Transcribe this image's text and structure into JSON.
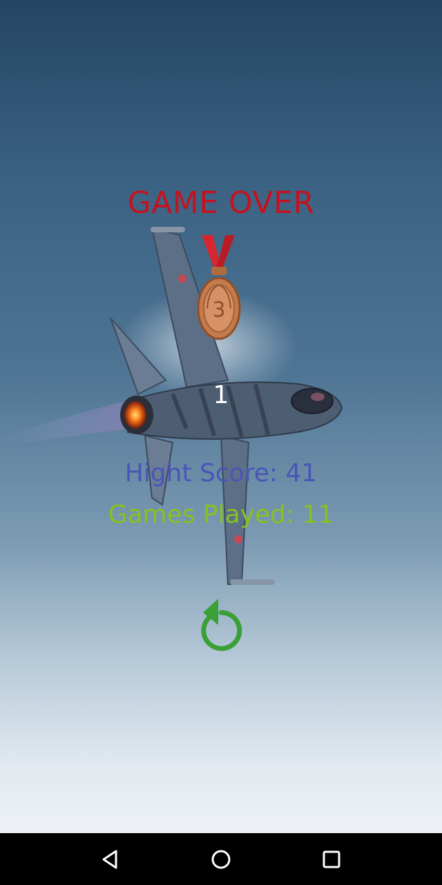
{
  "game": {
    "title": "GAME OVER",
    "score": "1",
    "high_score_label": "Hight Score: 41",
    "games_played_label": "Games Played: 11",
    "medal": "bronze-medal",
    "replay_icon": "replay-icon"
  },
  "colors": {
    "title": "#c5121f",
    "high_score": "#4a55b8",
    "games_played": "#86c21e",
    "replay": "#3aa035",
    "medal": "#c47a4a"
  },
  "navigation_bar": {
    "back_icon": "back-triangle-icon",
    "home_icon": "home-circle-icon",
    "recents_icon": "recents-square-icon"
  }
}
